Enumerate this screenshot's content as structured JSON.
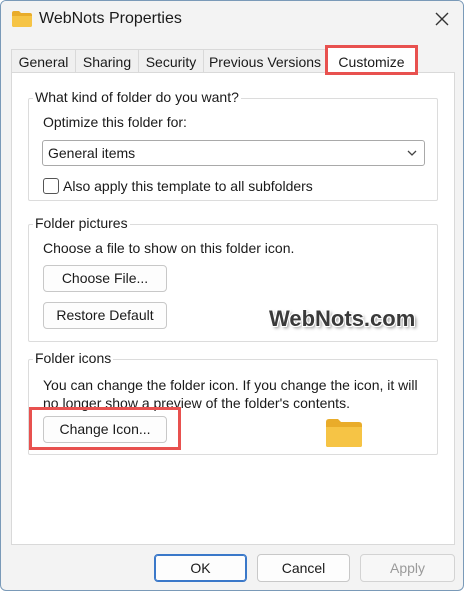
{
  "window": {
    "title": "WebNots Properties"
  },
  "tabs": [
    {
      "label": "General"
    },
    {
      "label": "Sharing"
    },
    {
      "label": "Security"
    },
    {
      "label": "Previous Versions"
    },
    {
      "label": "Customize"
    }
  ],
  "active_tab": "Customize",
  "folder_type": {
    "legend": "What kind of folder do you want?",
    "optimize_label": "Optimize this folder for:",
    "selected": "General items",
    "apply_subfolders_label": "Also apply this template to all subfolders",
    "apply_subfolders_checked": false
  },
  "folder_pictures": {
    "legend": "Folder pictures",
    "description": "Choose a file to show on this folder icon.",
    "choose_file_label": "Choose File...",
    "restore_default_label": "Restore Default"
  },
  "folder_icons": {
    "legend": "Folder icons",
    "description_line1": "You can change the folder icon. If you change the icon, it will",
    "description_line2": "no longer show a preview of the folder's contents.",
    "change_icon_label": "Change Icon..."
  },
  "watermark": "WebNots.com",
  "footer": {
    "ok_label": "OK",
    "cancel_label": "Cancel",
    "apply_label": "Apply"
  },
  "colors": {
    "highlight": "#e8514f",
    "folder": "#f6c445",
    "primary_border": "#3a78c9"
  }
}
